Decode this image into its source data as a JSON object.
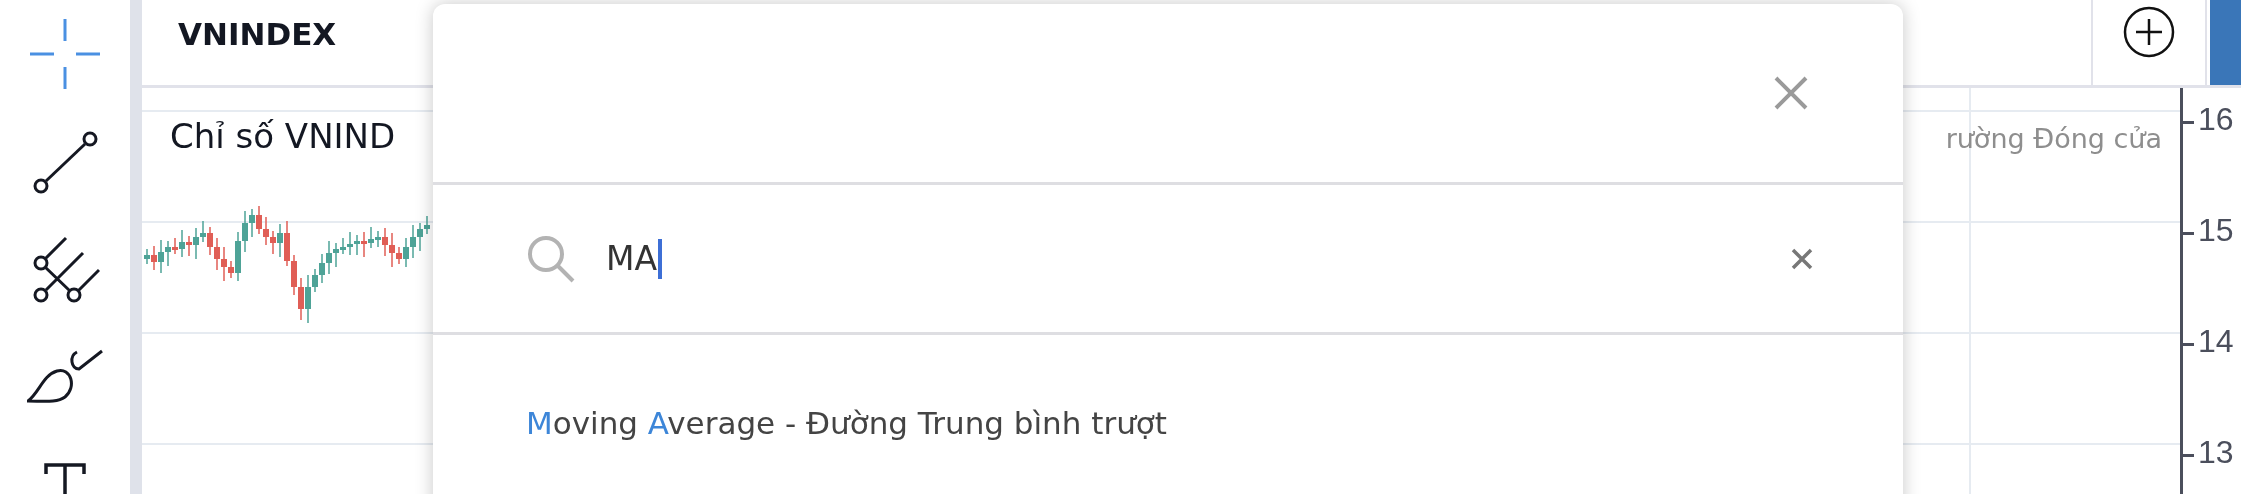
{
  "toolbar": {
    "tools": [
      {
        "kind": "crosshair",
        "selected": true
      },
      {
        "kind": "trend-line",
        "selected": false
      },
      {
        "kind": "pitchfork",
        "selected": false
      },
      {
        "kind": "brush",
        "selected": false
      },
      {
        "kind": "text",
        "selected": false
      }
    ]
  },
  "symbol": "VNINDEX",
  "legend": {
    "title": "Chỉ số VNIND",
    "source": "rường Đóng cửa"
  },
  "price_axis": {
    "labels": [
      "16",
      "15",
      "14",
      "13"
    ]
  },
  "indicator_dialog": {
    "search": {
      "value": "MA"
    },
    "results": [
      {
        "parts": [
          {
            "text": "M",
            "match": true
          },
          {
            "text": "oving ",
            "match": false
          },
          {
            "text": "A",
            "match": true
          },
          {
            "text": "verage - Đường Trung bình trượt",
            "match": false
          }
        ]
      }
    ]
  }
}
